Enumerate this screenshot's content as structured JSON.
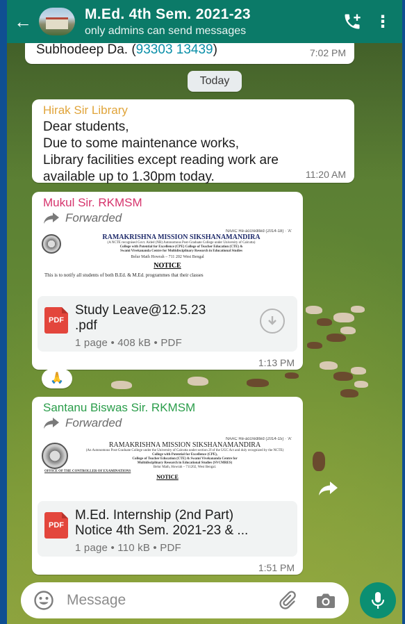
{
  "header": {
    "title": "M.Ed. 4th Sem. 2021-23",
    "subtitle": "only admins can send messages"
  },
  "messages": [
    {
      "text": "Subhodeep Da. (",
      "phone": "93303 13439",
      "text_end": ")",
      "time": "7:02 PM"
    }
  ],
  "date_chip": "Today",
  "msg_hirak": {
    "sender": "Hirak Sir Library",
    "sender_color": "#e0a43a",
    "lines": [
      "Dear students,",
      "Due to some maintenance works,",
      "Library facilities except reading work are",
      "available up to 1.30pm today."
    ],
    "time": "11:20 AM"
  },
  "msg_mukul": {
    "sender": "Mukul Sir. RKMSM",
    "sender_color": "#d6336c",
    "forwarded": "Forwarded",
    "preview": {
      "accreditation": "NAAC Re-accredited (2014-18) · 'A'",
      "org": "RAMAKRISHNA MISSION SIKSHANAMANDIRA",
      "small1": "(A NCTE recognised Govt. Aided (NB) Autonomous Post-Graduate College under University of Calcutta)",
      "small2": "College with Potential for Excellence (CPE) College of Teacher Education (CTE) &",
      "small3": "Swami Vivekananda Centre for Multidisciplinary Research in Educational Studies",
      "address": "Belur Math Howrah – 711 202 West Bengal",
      "notice": "NOTICE",
      "body": "This is to notify all students of both B.Ed. & M.Ed. programmes that their classes"
    },
    "file_name_line1": "Study Leave@12.5.23",
    "file_name_line2": ".pdf",
    "file_meta": "1 page • 408 kB • PDF",
    "time": "1:13 PM"
  },
  "reaction": "🙏",
  "msg_santanu": {
    "sender": "Santanu Biswas Sir. RKMSM",
    "sender_color": "#2a9d4a",
    "forwarded": "Forwarded",
    "preview": {
      "accreditation": "NAAC Re-accredited (2014-15) · 'A'",
      "org": "RAMAKRISHNA MISSION SIKSHANAMANDIRA",
      "small1": "(An Autonomous Post-Graduate College under the University of Calcutta under section 2f of the UGC Act and duly recognized by the NCTE)",
      "small2": "College with Potential for Excellence (CPE),",
      "small3": "College of Teacher Education (CTE) & Swami Vivekananda Centre for",
      "small4": "Multidisciplinary Research in Educational Studies (SVCMRES)",
      "address": "Belur Math, Howrah – 711202, West Bengal.",
      "office": "OFFICE OF THE CONTROLLER OF EXAMINATIONS",
      "notice": "NOTICE"
    },
    "file_name_line1": "M.Ed. Internship (2nd Part)",
    "file_name_line2": "Notice 4th Sem. 2021-23 & ...",
    "file_meta": "1 page • 110 kB • PDF",
    "time": "1:51 PM"
  },
  "input": {
    "placeholder": "Message"
  },
  "colors": {
    "header_bg": "#0b7a68",
    "link": "#0a8fa8",
    "mic_bg": "#0b8f72"
  },
  "icons": [
    "back-arrow-icon",
    "group-avatar",
    "add-call-icon",
    "menu-icon",
    "forward-icon",
    "pdf-icon",
    "download-icon",
    "share-icon",
    "emoji-icon",
    "attach-icon",
    "camera-icon",
    "mic-icon"
  ]
}
